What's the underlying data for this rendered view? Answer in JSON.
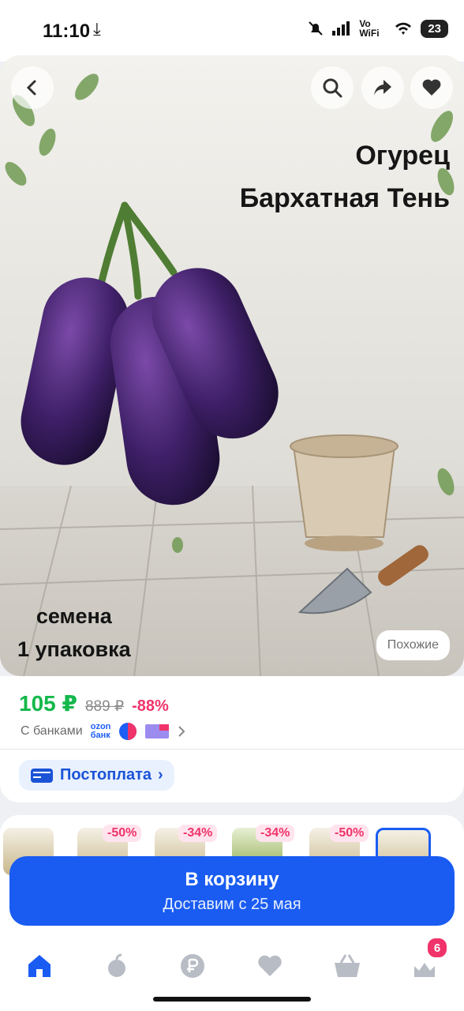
{
  "status_bar": {
    "time": "11:10",
    "signal_text": "Vo WiFi",
    "battery": "23"
  },
  "product": {
    "image_title_line1": "Огурец",
    "image_title_line2": "Бархатная Тень",
    "image_caption_line1": "семена",
    "image_caption_line2": "1 упаковка",
    "similar_label": "Похожие"
  },
  "pricing": {
    "current": "105 ₽",
    "old": "889 ₽",
    "discount": "-88%",
    "banks_label": "С банками",
    "ozon_top": "ozon",
    "ozon_bottom": "банк",
    "postpay_label": "Постоплата"
  },
  "recommendations": {
    "badges": [
      "-50%",
      "-34%",
      "-34%",
      "-50%"
    ]
  },
  "cart_button": {
    "label": "В корзину",
    "sub_label": "Доставим с 25 мая"
  },
  "bottom_nav": {
    "cart_count": "6"
  },
  "colors": {
    "accent": "#1a5cf2",
    "price": "#13b84b",
    "discount": "#f0336a"
  }
}
